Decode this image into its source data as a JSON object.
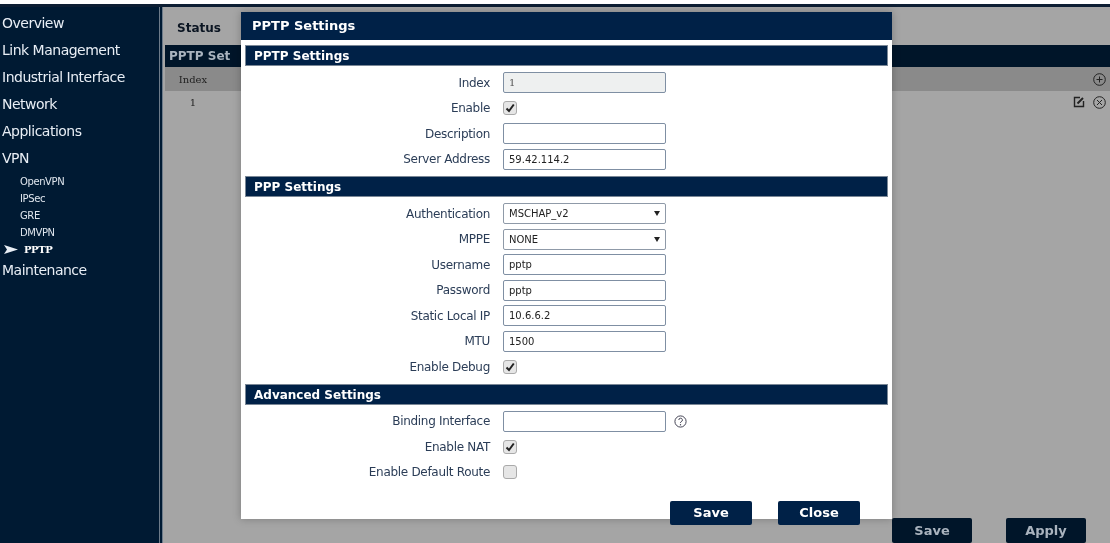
{
  "sidebar": {
    "items": [
      {
        "label": "Overview"
      },
      {
        "label": "Link Management"
      },
      {
        "label": "Industrial Interface"
      },
      {
        "label": "Network"
      },
      {
        "label": "Applications"
      },
      {
        "label": "VPN",
        "children": [
          {
            "label": "OpenVPN",
            "selected": false
          },
          {
            "label": "IPSec",
            "selected": false
          },
          {
            "label": "GRE",
            "selected": false
          },
          {
            "label": "DMVPN",
            "selected": false
          },
          {
            "label": "PPTP",
            "selected": true
          }
        ]
      },
      {
        "label": "Maintenance"
      }
    ]
  },
  "page": {
    "tabs": [
      {
        "label": "Status",
        "selected": true
      }
    ],
    "section_title": "PPTP Set",
    "table": {
      "columns": [
        "Index"
      ],
      "rows": [
        [
          "1"
        ]
      ]
    },
    "buttons": [
      "Save",
      "Apply"
    ]
  },
  "dialog": {
    "title": "PPTP Settings",
    "sections": [
      {
        "title": "PPTP Settings",
        "fields": [
          {
            "kind": "text",
            "label": "Index",
            "value": "1",
            "disabled": true
          },
          {
            "kind": "checkbox",
            "label": "Enable",
            "checked": true
          },
          {
            "kind": "text",
            "label": "Description",
            "disabled": false
          },
          {
            "kind": "text",
            "label": "Server Address",
            "value": "59.42.114.2",
            "disabled": false
          }
        ]
      },
      {
        "title": "PPP Settings",
        "fields": [
          {
            "kind": "select",
            "label": "Authentication",
            "value": "MSCHAP_v2"
          },
          {
            "kind": "select",
            "label": "MPPE",
            "value": "NONE"
          },
          {
            "kind": "text",
            "label": "Username",
            "value": "pptp",
            "disabled": false
          },
          {
            "kind": "text",
            "label": "Password",
            "value": "pptp",
            "disabled": false
          },
          {
            "kind": "text",
            "label": "Static Local IP",
            "value": "10.6.6.2",
            "disabled": false
          },
          {
            "kind": "text",
            "label": "MTU",
            "value": "1500",
            "disabled": false
          },
          {
            "kind": "checkbox",
            "label": "Enable Debug",
            "checked": true
          }
        ]
      },
      {
        "title": "Advanced Settings",
        "fields": [
          {
            "kind": "text",
            "label": "Binding Interface",
            "disabled": false,
            "help": true
          },
          {
            "kind": "checkbox",
            "label": "Enable NAT",
            "checked": true
          },
          {
            "kind": "checkbox",
            "label": "Enable Default Route",
            "checked": false
          }
        ]
      }
    ],
    "buttons": [
      "Save",
      "Close"
    ]
  }
}
